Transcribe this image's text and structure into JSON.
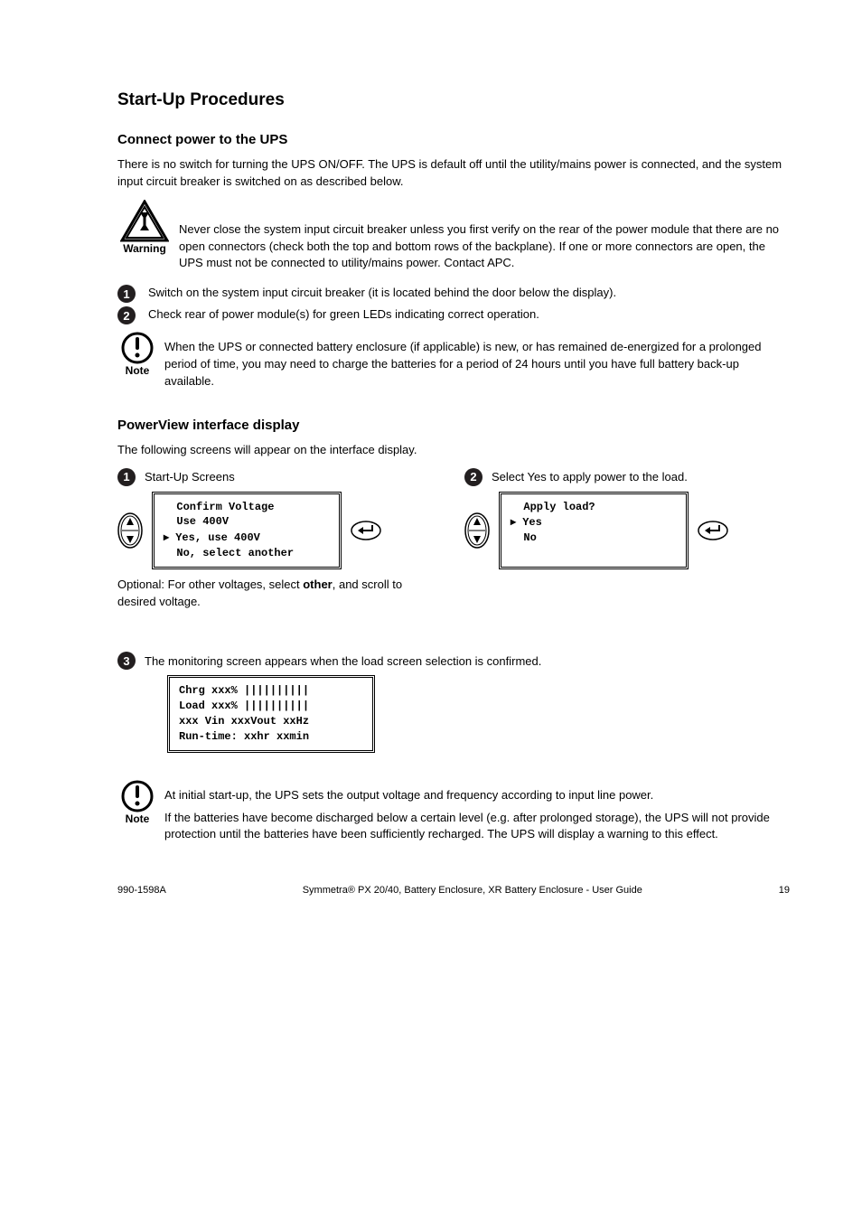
{
  "section": {
    "title": "Start-Up Procedures",
    "power_sub": "Connect power to the UPS",
    "power_para": "There is no switch for turning the UPS ON/OFF. The UPS is default off until the utility/mains power is connected, and the system input circuit breaker is switched on as described below.",
    "warning_text": "Never close the system input circuit breaker unless you first verify on the rear of the power module that there are no open connectors (check both the top and bottom rows of the backplane). If one or more connectors are open, the UPS must not be connected to utility/mains power. Contact APC.",
    "step1": "Switch on the system input circuit breaker (it is located behind the door below the display).",
    "step2": "Check rear of power module(s) for green LEDs indicating correct operation.",
    "note1_text": "When the UPS or connected battery enclosure (if applicable) is new, or has remained de-energized for a prolonged period of time, you may need to charge the batteries for a period of 24 hours until you have full battery back-up available.",
    "interface_sub": "PowerView interface display",
    "interface_para": "The following screens will appear on the interface display.",
    "disp1_head": "Start-Up Screens",
    "disp1_lines": [
      "Confirm Voltage",
      "Use 400V",
      "Yes, use 400V",
      "No, select another"
    ],
    "disp2_head": "Select Yes to apply power to the load.",
    "disp2_lines": [
      "Apply load?",
      "Yes",
      "No"
    ],
    "optional_line1": "Optional: For other voltages, select",
    "optional_strong": "other",
    "optional_line2": ", and scroll to desired voltage.",
    "monitor_head": "The monitoring screen appears when the load screen selection is confirmed.",
    "disp3_lines": [
      "Chrg xxx% ||||||||||",
      "Load xxx% ||||||||||",
      "xxx Vin xxxVout xxHz",
      "Run-time: xxhr xxmin"
    ],
    "note2_para1": "At initial start-up, the UPS sets the output voltage and frequency according to input line power.",
    "note2_para2": "If the batteries have become discharged below a certain level (e.g. after prolonged storage), the UPS will not provide protection until the batteries have been sufficiently recharged. The UPS will display a warning to this effect.",
    "footer_left": "990-1598A",
    "footer_center": "Symmetra® PX 20/40, Battery Enclosure, XR Battery Enclosure - User Guide",
    "footer_right": "19"
  },
  "labels": {
    "warning": "Warning",
    "note": "Note",
    "num1": "1",
    "num2": "2",
    "num3": "3"
  }
}
